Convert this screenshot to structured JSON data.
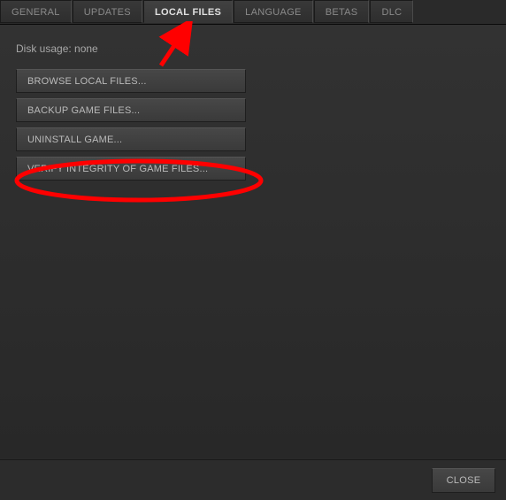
{
  "tabs": [
    {
      "label": "GENERAL",
      "active": false
    },
    {
      "label": "UPDATES",
      "active": false
    },
    {
      "label": "LOCAL FILES",
      "active": true
    },
    {
      "label": "LANGUAGE",
      "active": false
    },
    {
      "label": "BETAS",
      "active": false
    },
    {
      "label": "DLC",
      "active": false
    }
  ],
  "disk_usage_label": "Disk usage: none",
  "actions": {
    "browse": "BROWSE LOCAL FILES...",
    "backup": "BACKUP GAME FILES...",
    "uninstall": "UNINSTALL GAME...",
    "verify": "VERIFY INTEGRITY OF GAME FILES..."
  },
  "close_label": "CLOSE",
  "annotation_color": "#ff0000"
}
